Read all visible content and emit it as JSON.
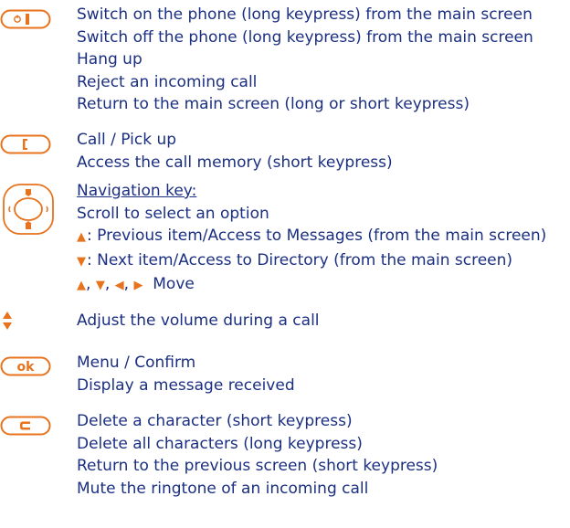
{
  "power_key": {
    "icon": "power-hangup-key-icon",
    "lines": [
      "Switch on the phone (long keypress) from the main screen",
      "Switch off the phone (long keypress) from the main screen",
      "Hang up",
      "Reject an incoming call",
      "Return to the main screen (long or short keypress)"
    ]
  },
  "call_key": {
    "icon": "call-pickup-key-icon",
    "lines": [
      "Call / Pick up",
      "Access the call memory (short keypress)"
    ]
  },
  "navigation_key": {
    "icon": "navigation-key-icon",
    "title": "Navigation key:",
    "scroll": "Scroll to select an option",
    "up_text": ": Previous item/Access to Messages (from the main screen)",
    "down_text": ": Next item/Access to Directory (from the main screen)",
    "move_text": "Move"
  },
  "volume_key": {
    "icon": "volume-key-icon",
    "lines": [
      "Adjust the volume during a call"
    ]
  },
  "ok_key": {
    "icon": "ok-key-icon",
    "label": "ok",
    "lines": [
      "Menu / Confirm",
      "Display a message received"
    ]
  },
  "clear_key": {
    "icon": "clear-key-icon",
    "label": "C",
    "lines": [
      "Delete a character (short keypress)",
      "Delete all characters (long keypress)",
      "Return to the previous screen (short keypress)",
      "Mute the ringtone of an incoming call"
    ]
  },
  "colors": {
    "text": "#1b2f82",
    "accent": "#e8731f"
  }
}
